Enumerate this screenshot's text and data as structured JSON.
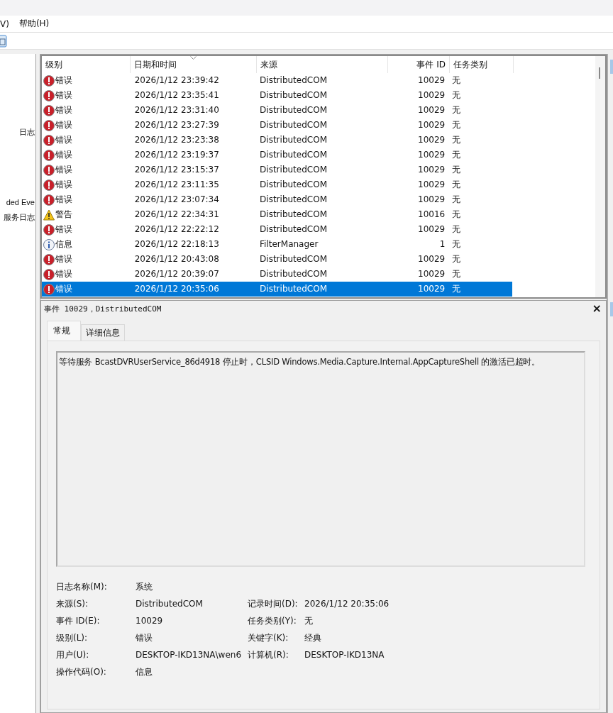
{
  "menu": [
    {
      "label": "V)"
    },
    {
      "label": "帮助(H)"
    }
  ],
  "sidebar": {
    "items": [
      {
        "label": "日志"
      },
      {
        "label": "ded Eve"
      },
      {
        "label": "服务日志"
      }
    ]
  },
  "table": {
    "columns": [
      {
        "label": "级别"
      },
      {
        "label": "日期和时间",
        "sorted": true
      },
      {
        "label": "来源"
      },
      {
        "label": "事件 ID"
      },
      {
        "label": "任务类别"
      }
    ],
    "rows": [
      {
        "kind": "error",
        "level": "错误",
        "date": "2026/1/12 23:39:42",
        "source": "DistributedCOM",
        "id": "10029",
        "task": "无",
        "selected": false
      },
      {
        "kind": "error",
        "level": "错误",
        "date": "2026/1/12 23:35:41",
        "source": "DistributedCOM",
        "id": "10029",
        "task": "无",
        "selected": false
      },
      {
        "kind": "error",
        "level": "错误",
        "date": "2026/1/12 23:31:40",
        "source": "DistributedCOM",
        "id": "10029",
        "task": "无",
        "selected": false
      },
      {
        "kind": "error",
        "level": "错误",
        "date": "2026/1/12 23:27:39",
        "source": "DistributedCOM",
        "id": "10029",
        "task": "无",
        "selected": false
      },
      {
        "kind": "error",
        "level": "错误",
        "date": "2026/1/12 23:23:38",
        "source": "DistributedCOM",
        "id": "10029",
        "task": "无",
        "selected": false
      },
      {
        "kind": "error",
        "level": "错误",
        "date": "2026/1/12 23:19:37",
        "source": "DistributedCOM",
        "id": "10029",
        "task": "无",
        "selected": false
      },
      {
        "kind": "error",
        "level": "错误",
        "date": "2026/1/12 23:15:37",
        "source": "DistributedCOM",
        "id": "10029",
        "task": "无",
        "selected": false
      },
      {
        "kind": "error",
        "level": "错误",
        "date": "2026/1/12 23:11:35",
        "source": "DistributedCOM",
        "id": "10029",
        "task": "无",
        "selected": false
      },
      {
        "kind": "error",
        "level": "错误",
        "date": "2026/1/12 23:07:34",
        "source": "DistributedCOM",
        "id": "10029",
        "task": "无",
        "selected": false
      },
      {
        "kind": "warning",
        "level": "警告",
        "date": "2026/1/12 22:34:31",
        "source": "DistributedCOM",
        "id": "10016",
        "task": "无",
        "selected": false
      },
      {
        "kind": "error",
        "level": "错误",
        "date": "2026/1/12 22:22:12",
        "source": "DistributedCOM",
        "id": "10029",
        "task": "无",
        "selected": false
      },
      {
        "kind": "info",
        "level": "信息",
        "date": "2026/1/12 22:18:13",
        "source": "FilterManager",
        "id": "1",
        "task": "无",
        "selected": false
      },
      {
        "kind": "error",
        "level": "错误",
        "date": "2026/1/12 20:43:08",
        "source": "DistributedCOM",
        "id": "10029",
        "task": "无",
        "selected": false
      },
      {
        "kind": "error",
        "level": "错误",
        "date": "2026/1/12 20:39:07",
        "source": "DistributedCOM",
        "id": "10029",
        "task": "无",
        "selected": false
      },
      {
        "kind": "error",
        "level": "错误",
        "date": "2026/1/12 20:35:06",
        "source": "DistributedCOM",
        "id": "10029",
        "task": "无",
        "selected": true
      }
    ]
  },
  "detail": {
    "title": "事件 10029，DistributedCOM",
    "close": "×",
    "tabs": [
      {
        "label": "常规",
        "selected": true
      },
      {
        "label": "详细信息",
        "selected": false
      }
    ],
    "message": "等待服务 BcastDVRUserService_86d4918 停止时，CLSID Windows.Media.Capture.Internal.AppCaptureShell 的激活已超时。",
    "fields": [
      {
        "left": {
          "label": "日志名称(M):",
          "value": "系统"
        }
      },
      {
        "left": {
          "label": "来源(S):",
          "value": "DistributedCOM"
        },
        "right": {
          "label": "记录时间(D):",
          "value": "2026/1/12 20:35:06"
        }
      },
      {
        "left": {
          "label": "事件 ID(E):",
          "value": "10029"
        },
        "right": {
          "label": "任务类别(Y):",
          "value": "无"
        }
      },
      {
        "left": {
          "label": "级别(L):",
          "value": "错误"
        },
        "right": {
          "label": "关键字(K):",
          "value": "经典"
        }
      },
      {
        "left": {
          "label": "用户(U):",
          "value": "DESKTOP-IKD13NA\\wen6"
        },
        "right": {
          "label": "计算机(R):",
          "value": "DESKTOP-IKD13NA"
        }
      },
      {
        "left": {
          "label": "操作代码(O):",
          "value": "信息"
        }
      }
    ]
  }
}
